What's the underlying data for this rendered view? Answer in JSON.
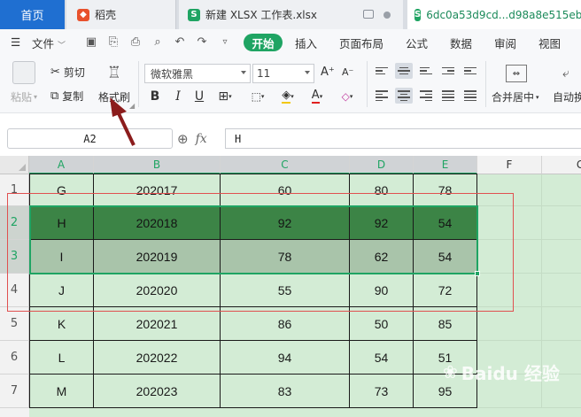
{
  "tabs": {
    "home": "首页",
    "docer": "稻壳",
    "xlsx": "新建 XLSX 工作表.xlsx",
    "active": "6dc0a53d9cd...d98a8e515eb"
  },
  "menu": {
    "file": "文件",
    "start": "开始",
    "items": [
      "插入",
      "页面布局",
      "公式",
      "数据",
      "审阅",
      "视图"
    ]
  },
  "ribbon": {
    "paste": "粘贴",
    "cut": "剪切",
    "copy": "复制",
    "format_painter": "格式刷",
    "font_name": "微软雅黑",
    "font_size": "11",
    "merge": "合并居中",
    "autowrap": "自动换"
  },
  "formula_bar": {
    "cell_ref": "A2",
    "fx": "fx",
    "value": "H"
  },
  "sheet": {
    "columns": [
      "A",
      "B",
      "C",
      "D",
      "E",
      "F",
      "G"
    ],
    "rows": [
      {
        "num": "1",
        "cells": [
          "G",
          "202017",
          "60",
          "80",
          "78"
        ]
      },
      {
        "num": "2",
        "cells": [
          "H",
          "202018",
          "92",
          "92",
          "54"
        ]
      },
      {
        "num": "3",
        "cells": [
          "I",
          "202019",
          "78",
          "62",
          "54"
        ]
      },
      {
        "num": "4",
        "cells": [
          "J",
          "202020",
          "55",
          "90",
          "72"
        ]
      },
      {
        "num": "5",
        "cells": [
          "K",
          "202021",
          "86",
          "50",
          "85"
        ]
      },
      {
        "num": "6",
        "cells": [
          "L",
          "202022",
          "94",
          "54",
          "51"
        ]
      },
      {
        "num": "7",
        "cells": [
          "M",
          "202023",
          "83",
          "73",
          "95"
        ]
      }
    ]
  },
  "watermark": "Baidu 经验"
}
